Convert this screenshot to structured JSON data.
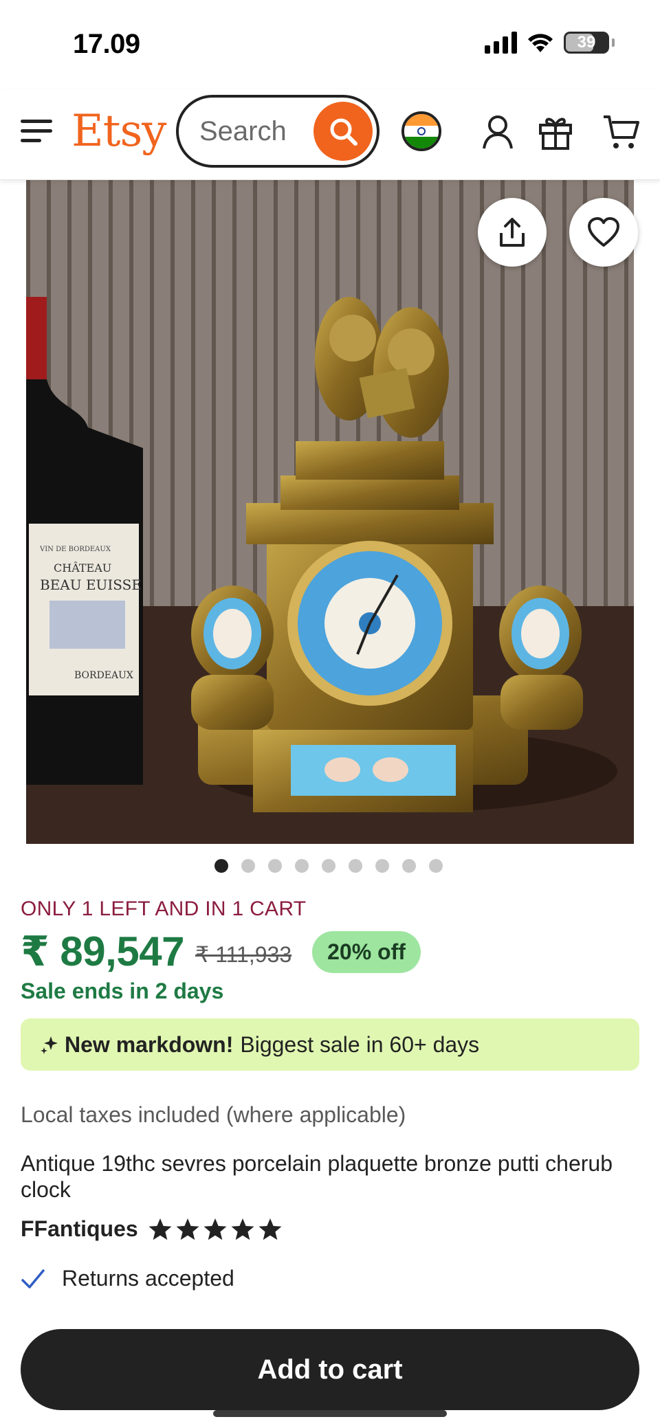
{
  "status_bar": {
    "time": "17.09",
    "battery": "39"
  },
  "header": {
    "logo": "Etsy",
    "search_placeholder": "Search",
    "icons": [
      "menu-icon",
      "search-icon",
      "india-flag-icon",
      "account-icon",
      "gift-icon",
      "cart-icon"
    ]
  },
  "gallery": {
    "image_count": 9,
    "active_index": 0,
    "image_alt": "Antique bronze clock with cherubs and sevres porcelain plaques next to a wine bottle",
    "bottle_label": [
      "VIN DE BORDEAUX",
      "CHÂTEAU",
      "BEAU EUISSE",
      "BORDEAUX"
    ]
  },
  "product": {
    "stock_text": "ONLY 1 LEFT AND IN 1 CART",
    "price": "₹ 89,547",
    "original_price": "₹ 111,933",
    "discount": "20% off",
    "sale_ends": "Sale ends in 2 days",
    "markdown_bold": "New markdown!",
    "markdown_rest": "Biggest sale in 60+ days",
    "taxes": "Local taxes included (where applicable)",
    "title": "Antique 19thc sevres porcelain plaquette bronze putti cherub clock",
    "shop_name": "FFantiques",
    "rating": 5,
    "returns": "Returns accepted",
    "add_to_cart": "Add to cart"
  },
  "colors": {
    "brand": "#f1641e",
    "price_green": "#1e7a43",
    "stock_red": "#8b1d3f",
    "discount_bg": "#9ee59f",
    "banner_bg": "#e0f7b1",
    "button_dark": "#222222"
  }
}
